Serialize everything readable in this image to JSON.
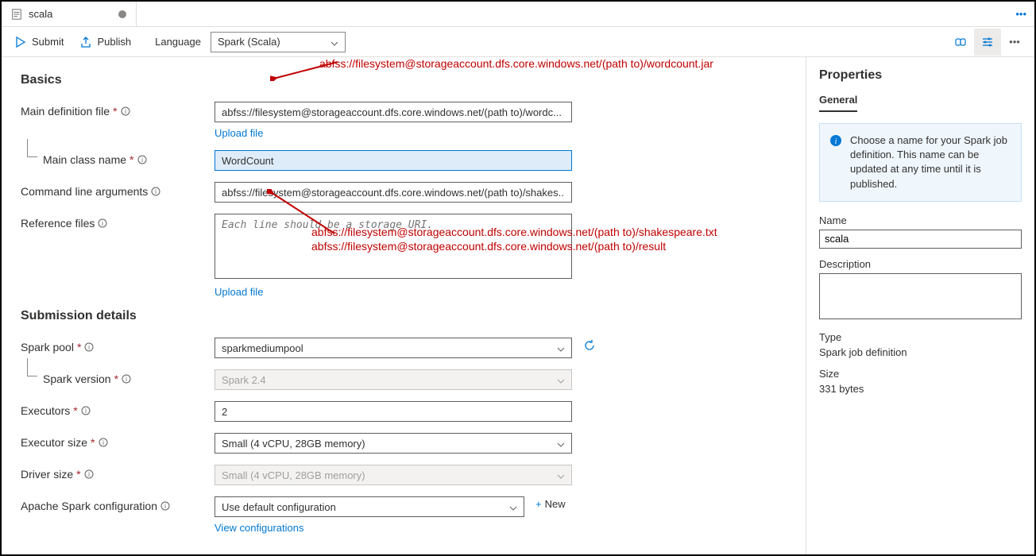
{
  "tab": {
    "title": "scala"
  },
  "toolbar": {
    "submit": "Submit",
    "publish": "Publish",
    "language_label": "Language",
    "language_value": "Spark (Scala)"
  },
  "annotations": {
    "a1": "abfss://filesystem@storageaccount.dfs.core.windows.net/(path to)/wordcount.jar",
    "a2": "abfss://filesystem@storageaccount.dfs.core.windows.net/(path to)/shakespeare.txt",
    "a3": "abfss://filesystem@storageaccount.dfs.core.windows.net/(path to)/result"
  },
  "basics": {
    "heading": "Basics",
    "main_def_label": "Main definition file",
    "main_def_value": "abfss://filesystem@storageaccount.dfs.core.windows.net/(path to)/wordc...",
    "upload_file": "Upload file",
    "main_class_label": "Main class name",
    "main_class_value": "WordCount",
    "cmd_args_label": "Command line arguments",
    "cmd_args_value": "abfss://filesystem@storageaccount.dfs.core.windows.net/(path to)/shakes...",
    "ref_files_label": "Reference files",
    "ref_files_placeholder": "Each line should be a storage URI."
  },
  "submission": {
    "heading": "Submission details",
    "spark_pool_label": "Spark pool",
    "spark_pool_value": "sparkmediumpool",
    "spark_version_label": "Spark version",
    "spark_version_value": "Spark 2.4",
    "executors_label": "Executors",
    "executors_value": "2",
    "exec_size_label": "Executor size",
    "exec_size_value": "Small (4 vCPU, 28GB memory)",
    "driver_size_label": "Driver size",
    "driver_size_value": "Small (4 vCPU, 28GB memory)",
    "spark_config_label": "Apache Spark configuration",
    "spark_config_value": "Use default configuration",
    "new_label": "New",
    "view_config": "View configurations"
  },
  "properties": {
    "heading": "Properties",
    "tab_general": "General",
    "info_text": "Choose a name for your Spark job definition. This name can be updated at any time until it is published.",
    "name_label": "Name",
    "name_value": "scala",
    "desc_label": "Description",
    "type_label": "Type",
    "type_value": "Spark job definition",
    "size_label": "Size",
    "size_value": "331 bytes"
  }
}
